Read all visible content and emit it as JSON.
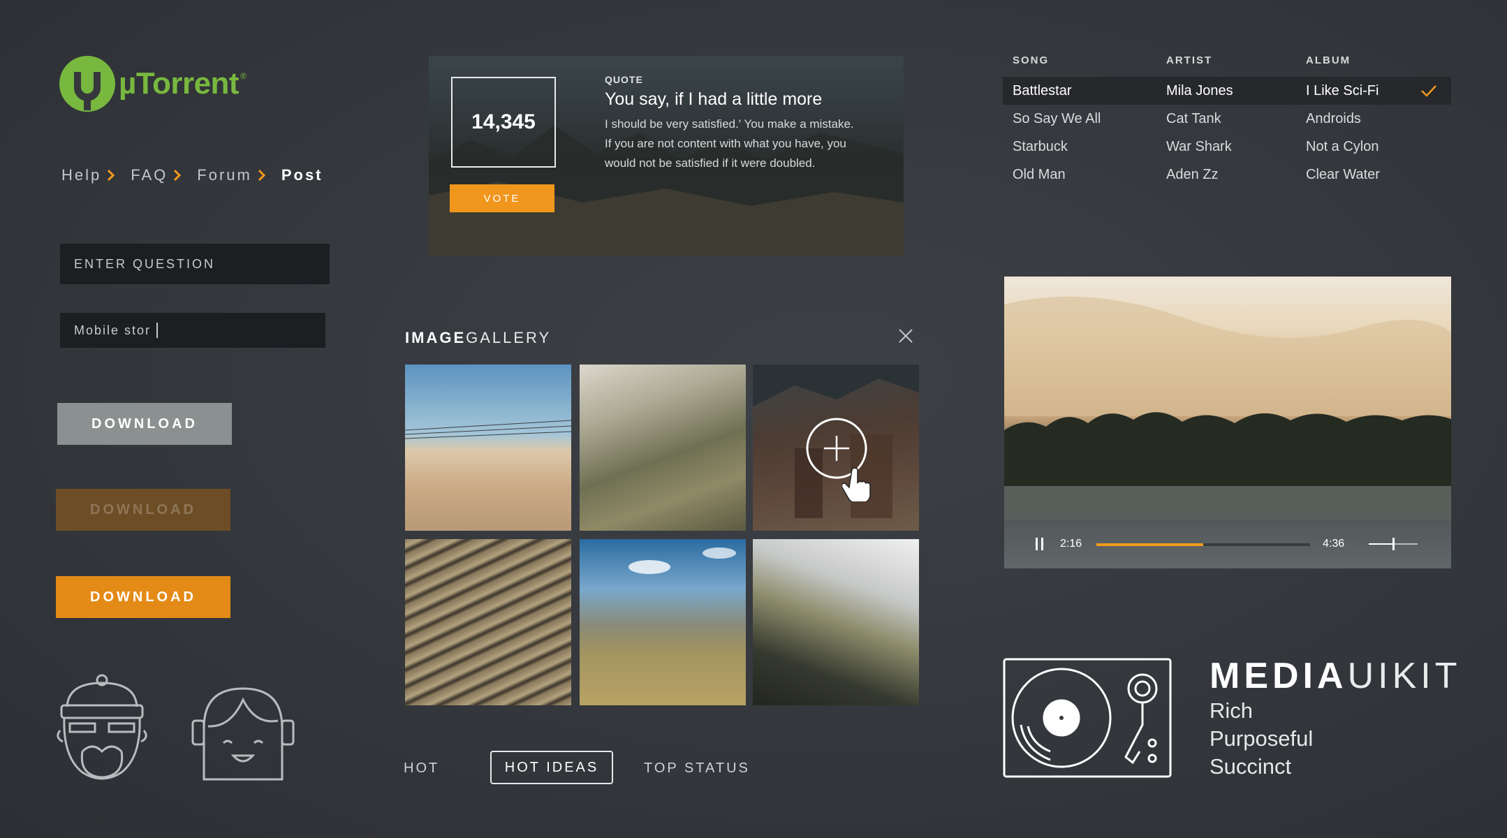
{
  "brand": {
    "name": "µTorrent",
    "registered": "®"
  },
  "breadcrumb": {
    "items": [
      {
        "label": "Help"
      },
      {
        "label": "FAQ"
      },
      {
        "label": "Forum"
      },
      {
        "label": "Post"
      }
    ],
    "accent": "#f39a1e"
  },
  "inputs": {
    "question": {
      "placeholder": "ENTER QUESTION"
    },
    "mobile": {
      "value": "Mobile stor"
    }
  },
  "buttons": {
    "download_gray": "DOWNLOAD",
    "download_muted": "DOWNLOAD",
    "download_orange": "DOWNLOAD"
  },
  "quote_card": {
    "vote_count": "14,345",
    "vote_label": "VOTE",
    "label": "QUOTE",
    "title": "You say, if I had a little more",
    "body": "I should be very satisfied.' You make a mistake. If you are not content with what you have, you would not be satisfied if it were doubled."
  },
  "gallery": {
    "title_bold": "IMAGE",
    "title_light": "GALLERY",
    "thumbnails": [
      {
        "subject": "desert dunes with power lines"
      },
      {
        "subject": "grassy hillside"
      },
      {
        "subject": "stone ruins with add overlay"
      },
      {
        "subject": "terraced hills"
      },
      {
        "subject": "highland valley"
      },
      {
        "subject": "misty mountain peak"
      }
    ]
  },
  "tabs": [
    {
      "label": "HOT",
      "active": false
    },
    {
      "label": "HOT IDEAS",
      "active": true
    },
    {
      "label": "TOP STATUS",
      "active": false
    }
  ],
  "song_table": {
    "headers": {
      "song": "SONG",
      "artist": "ARTIST",
      "album": "ALBUM"
    },
    "rows": [
      {
        "song": "Battlestar",
        "artist": "Mila Jones",
        "album": "I Like Sci-Fi",
        "selected": true
      },
      {
        "song": "So Say We All",
        "artist": "Cat Tank",
        "album": "Androids",
        "selected": false
      },
      {
        "song": "Starbuck",
        "artist": "War Shark",
        "album": "Not a Cylon",
        "selected": false
      },
      {
        "song": "Old Man",
        "artist": "Aden Zz",
        "album": "Clear Water",
        "selected": false
      }
    ],
    "check_color": "#f39a1e"
  },
  "video": {
    "current_time": "2:16",
    "total_time": "4:36",
    "progress": 0.5,
    "volume": 0.5,
    "progress_color": "#f39a1e"
  },
  "kit": {
    "title_bold": "MEDIA",
    "title_light": "UIKIT",
    "taglines": [
      "Rich",
      "Purposeful",
      "Succinct"
    ]
  },
  "colors": {
    "background": "#35383c",
    "brand_green": "#78b83f",
    "accent_orange": "#e48a16",
    "muted_brown": "#6d4d26",
    "gray_button": "#8b9190"
  }
}
